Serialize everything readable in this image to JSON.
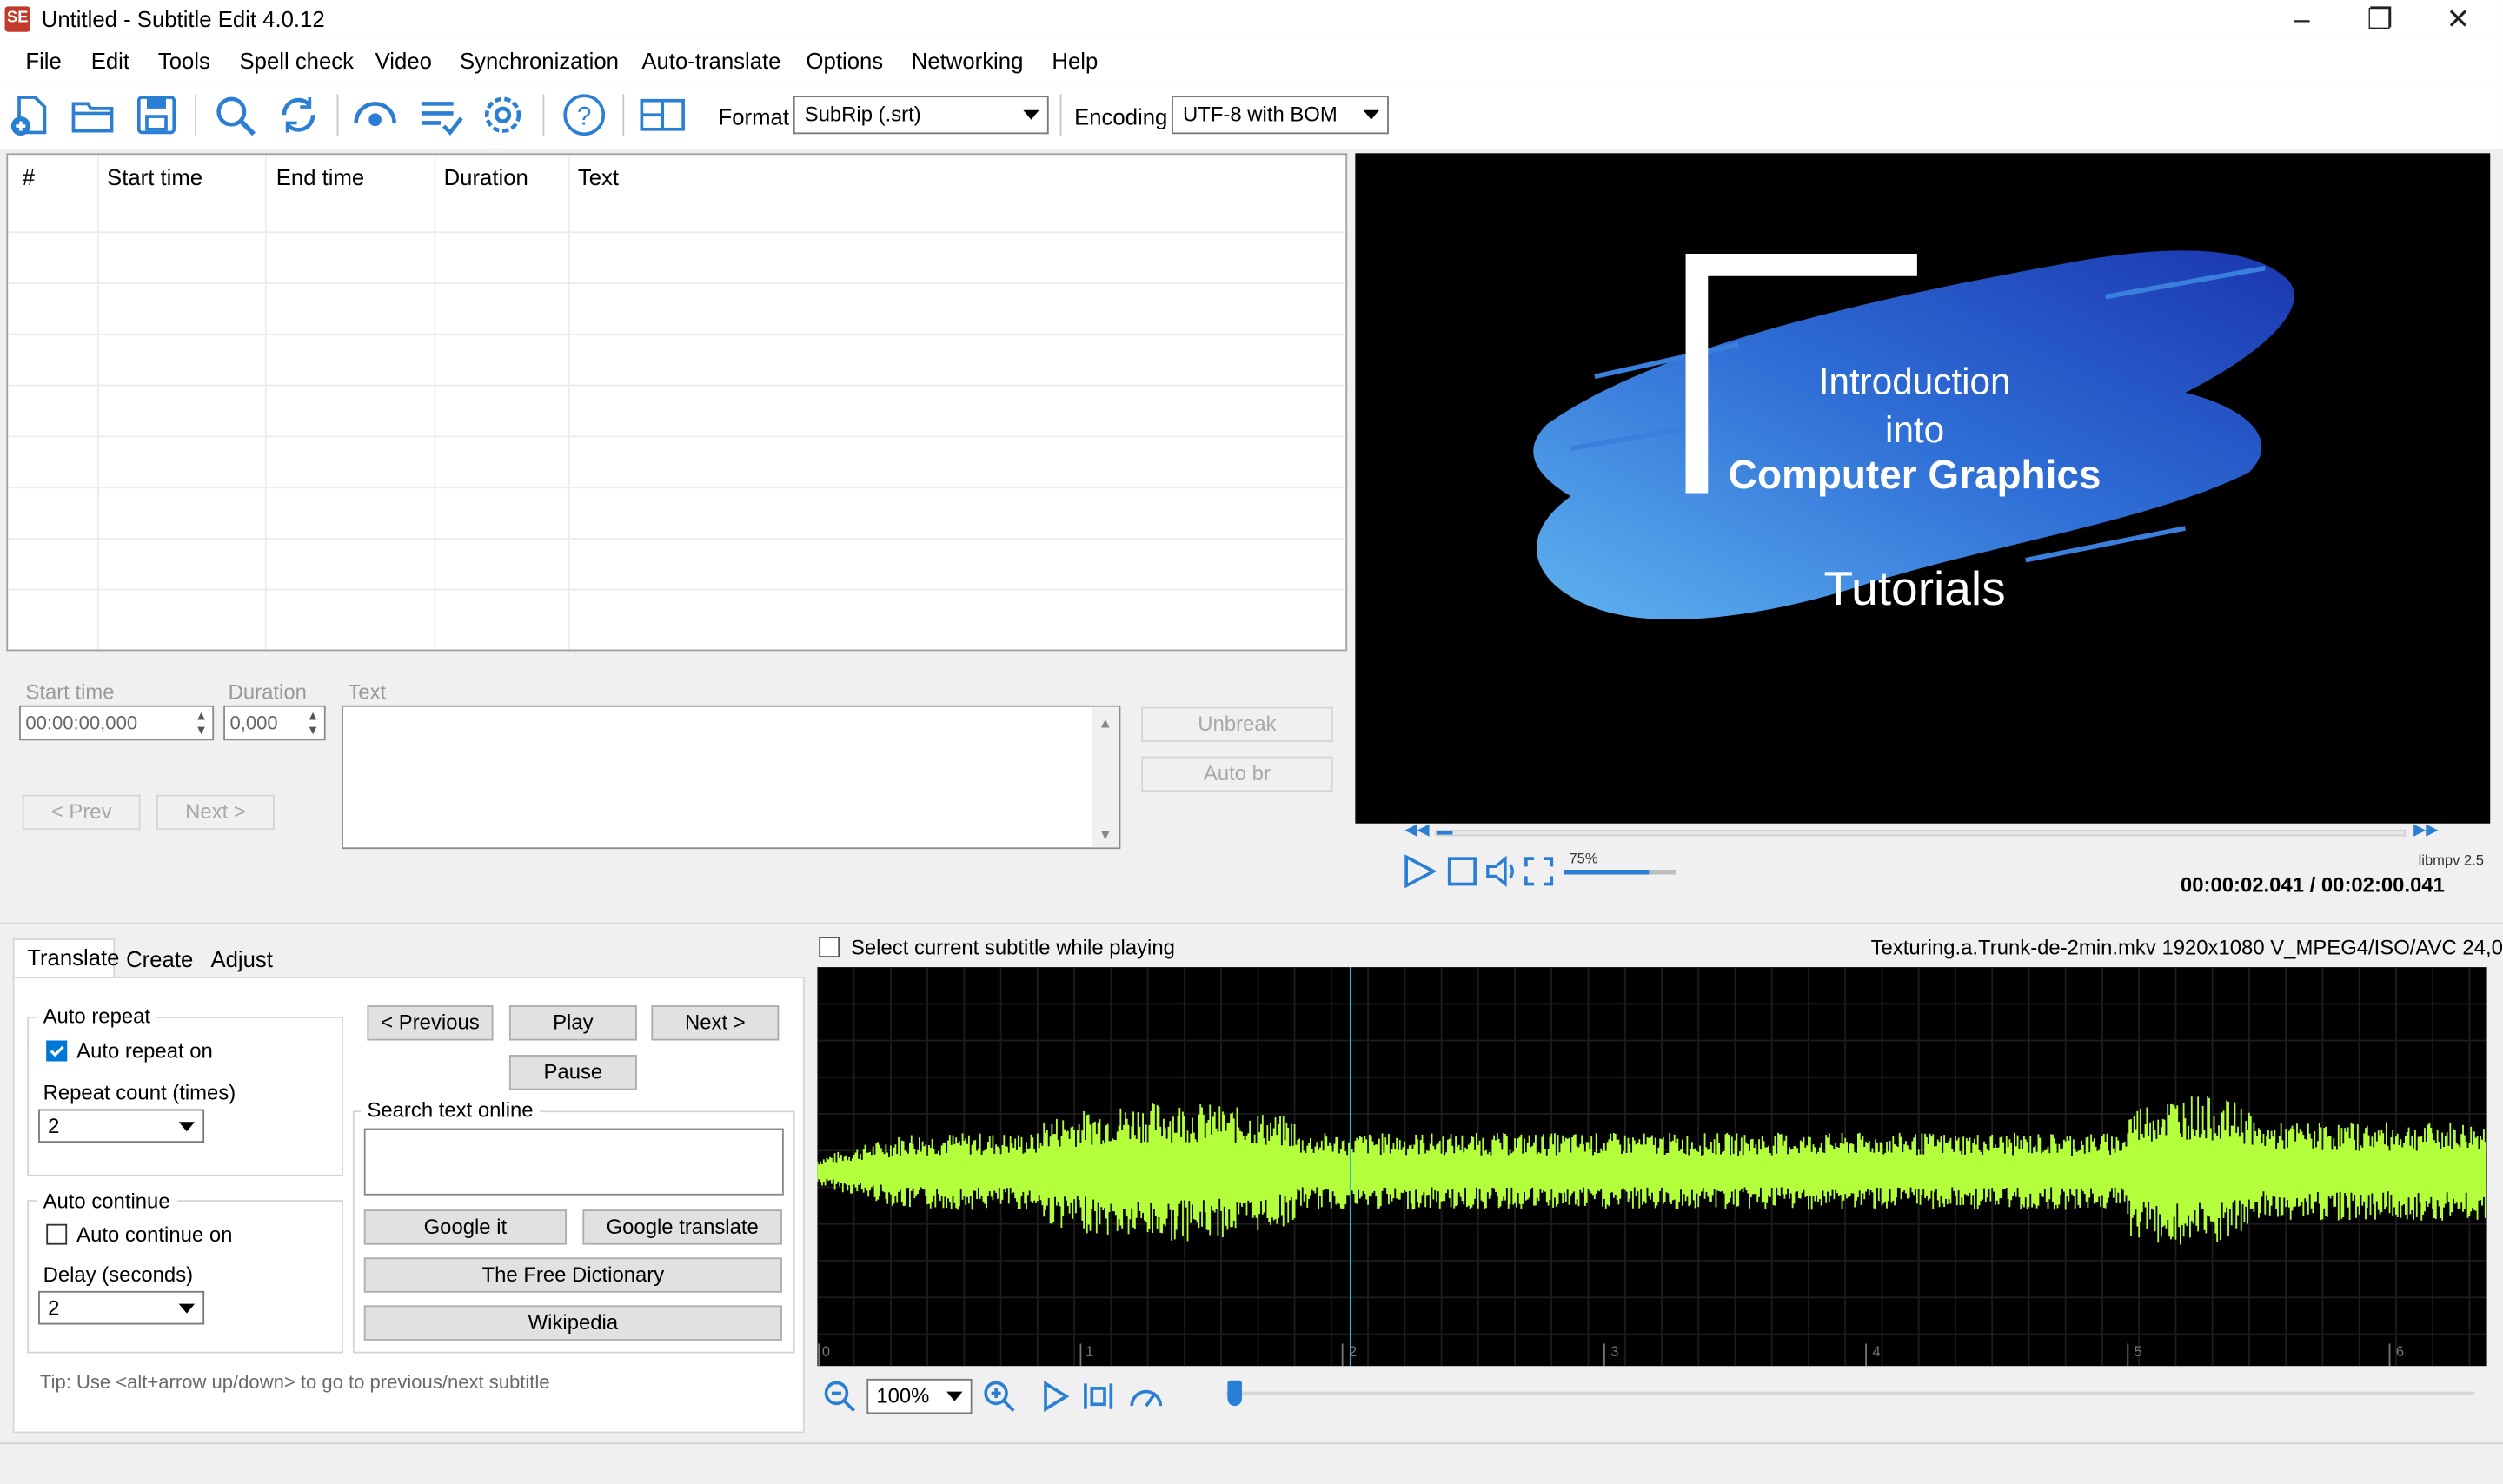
{
  "window": {
    "title": "Untitled - Subtitle Edit 4.0.12",
    "app_icon": "SE"
  },
  "menu": [
    "File",
    "Edit",
    "Tools",
    "Spell check",
    "Video",
    "Synchronization",
    "Auto-translate",
    "Options",
    "Networking",
    "Help"
  ],
  "toolbar": {
    "format_label": "Format",
    "format_value": "SubRip (.srt)",
    "encoding_label": "Encoding",
    "encoding_value": "UTF-8 with BOM"
  },
  "grid": {
    "headers": [
      "#",
      "Start time",
      "End time",
      "Duration",
      "Text"
    ]
  },
  "editor": {
    "start_label": "Start time",
    "start_value": "00:00:00,000",
    "duration_label": "Duration",
    "duration_value": "0,000",
    "text_label": "Text",
    "unbreak": "Unbreak",
    "autobr": "Auto br",
    "prev": "< Prev",
    "next": "Next >"
  },
  "video": {
    "line1": "Introduction",
    "line2": "into",
    "line3": "Computer Graphics",
    "line4": "Tutorials",
    "engine": "libmpv 2.5",
    "volume": "75%",
    "volume_level": 0.75,
    "position": "00:00:02.041 / 00:02:00.041",
    "position_fraction": 0.017
  },
  "tabs": [
    "Translate",
    "Create",
    "Adjust"
  ],
  "translate": {
    "auto_repeat_title": "Auto repeat",
    "auto_repeat_on": "Auto repeat on",
    "repeat_count_label": "Repeat count (times)",
    "repeat_count": "2",
    "auto_continue_title": "Auto continue",
    "auto_continue_on": "Auto continue on",
    "delay_label": "Delay (seconds)",
    "delay": "2",
    "previous": "< Previous",
    "play": "Play",
    "next": "Next >",
    "pause": "Pause",
    "search_label": "Search text online",
    "google_it": "Google it",
    "google_translate": "Google translate",
    "free_dictionary": "The Free Dictionary",
    "wikipedia": "Wikipedia",
    "tip": "Tip: Use <alt+arrow up/down> to go to previous/next subtitle"
  },
  "waveform": {
    "select_current": "Select current subtitle while playing",
    "file_info": "Texturing.a.Trunk-de-2min.mkv 1920x1080 V_MPEG4/ISO/AVC 24,0",
    "zoom": "100%",
    "ticks": [
      "0",
      "1",
      "2",
      "3",
      "4",
      "5",
      "6"
    ],
    "wave_color": "#b4ff3c"
  }
}
